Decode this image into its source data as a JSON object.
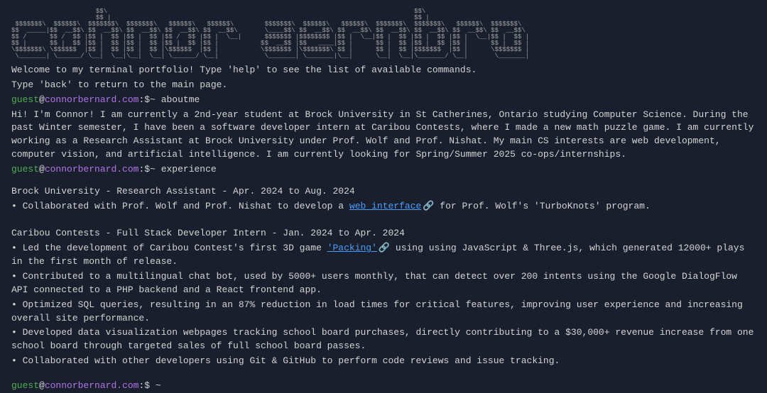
{
  "ascii_art": "                      $$\\                                                                                $$\\\n                      $$ |                                                                               $$ |\n $$$$$$$\\  $$$$$$\\  $$$$$$$\\  $$$$$$$\\   $$$$$$\\   $$$$$$\\        $$$$$$$\\  $$$$$$\\   $$$$$$\\  $$$$$$$\\  $$$$$$$\\   $$$$$$\\  $$$$$$$\\\n$$  _____|$$  __$$\\ $$  __$$\\ $$  __$$\\ $$  __$$\\ $$  __$$\\       \\____$$\\ $$  __$$\\ $$  __$$\\ $$  __$$\\ $$  __$$\\ $$  __$$\\ $$  __$$\\\n$$ /      $$ /  $$ |$$ |  $$ |$$ |  $$ |$$ /  $$ |$$ |  \\__|      $$$$$$$ |$$$$$$$$ |$$ |  \\__|$$ |  $$ |$$ |  $$ |$$ |  \\__|$$ |  $$ |\n$$ |      $$ |  $$ |$$ |  $$ |$$ |  $$ |$$ |  $$ |$$ |           $$  __$$ |$$   ____|$$ |      $$ |  $$ |$$ |  $$ |$$ |      $$ |  $$ |\n\\$$$$$$$\\ \\$$$$$$  |$$ |  $$ |$$ |  $$ |\\$$$$$$  |$$ |           \\$$$$$$$ |\\$$$$$$$\\ $$ |      $$ |  $$ |$$$$$$$  |$$ |      \\$$$$$$$ |\n \\_______| \\______/ \\__|  \\__|\\__|  \\__| \\______/ \\__|            \\_______| \\_______|\\__|      \\__|  \\__|\\_______/ \\__|       \\_______|",
  "welcome_line1": "Welcome to my terminal portfolio! Type 'help' to see the list of available commands.",
  "welcome_line2": "Type 'back' to return to the main page.",
  "prompt": {
    "user": "guest",
    "at": "@",
    "host": "connorbernard.com",
    "colon": ":",
    "dollar": "$",
    "tilde": "~"
  },
  "commands": {
    "aboutme": "aboutme",
    "experience": "experience"
  },
  "aboutme_output": "Hi! I'm Connor! I am currently a 2nd-year student at Brock University in St Catherines, Ontario studying Computer Science. During the past Winter semester, I have been a software developer intern at Caribou Contests, where I made a new math puzzle game. I am currently working as a Research Assistant at Brock University under Prof. Wolf and Prof. Nishat. My main CS interests are web development, computer vision, and artificial intelligence. I am currently looking for Spring/Summer 2025 co-ops/internships.",
  "experience": {
    "brock": {
      "title": "Brock University - Research Assistant - Apr. 2024 to Aug. 2024",
      "bullet1_prefix": "• Collaborated with Prof. Wolf and Prof. Nishat to develop a ",
      "link1_text": "web interface",
      "bullet1_suffix": " for Prof. Wolf's 'TurboKnots' program."
    },
    "caribou": {
      "title": "Caribou Contests - Full Stack Developer Intern - Jan. 2024 to Apr. 2024",
      "bullet1_prefix": "• Led the development of Caribou Contest's first 3D game ",
      "link1_text": "'Packing'",
      "bullet1_suffix": " using using JavaScript & Three.js, which generated 12000+ plays in the first month of release.",
      "bullet2": "• Contributed to a multilingual chat bot, used by 5000+ users monthly, that can detect over 200 intents using the Google DialogFlow API connected to a PHP backend and a React frontend app.",
      "bullet3": "• Optimized SQL queries, resulting in an 87% reduction in load times for critical features, improving user experience and increasing overall site performance.",
      "bullet4": "• Developed data visualization webpages tracking school board purchases, directly contributing to a $30,000+ revenue increase from one school board through targeted sales of full school board passes.",
      "bullet5": "• Collaborated with other developers using Git & GitHub to perform code reviews and issue tracking."
    }
  },
  "link_icon": "🔗"
}
